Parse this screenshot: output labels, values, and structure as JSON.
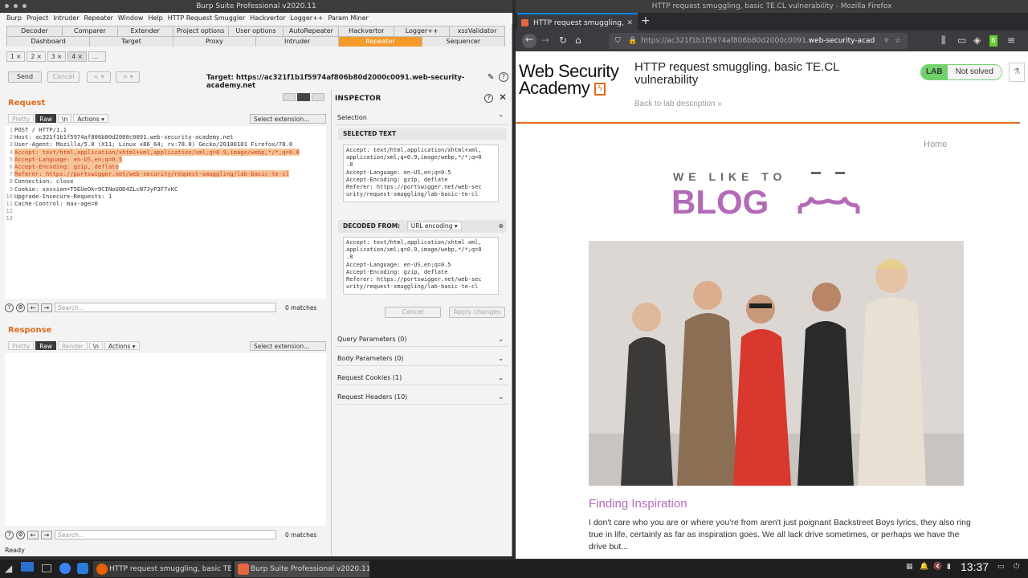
{
  "burp": {
    "title": "Burp Suite Professional v2020.11",
    "menu": [
      "Burp",
      "Project",
      "Intruder",
      "Repeater",
      "Window",
      "Help",
      "HTTP Request Smuggler",
      "Hackvertor",
      "Logger++",
      "Param Miner"
    ],
    "tabs_row1": [
      "Decoder",
      "Comparer",
      "Extender",
      "Project options",
      "User options",
      "AutoRepeater",
      "Hackvertor",
      "Logger++",
      "xssValidator"
    ],
    "tabs_row2": [
      "Dashboard",
      "Target",
      "Proxy",
      "Intruder",
      "Repeater",
      "Sequencer"
    ],
    "active_tab": "Repeater",
    "subtabs": [
      "1 ×",
      "2 ×",
      "3 ×",
      "4 ×",
      "..."
    ],
    "send_label": "Send",
    "cancel_label": "Cancel",
    "back_label": "< ▾",
    "fwd_label": "> ▾",
    "target": "Target: https://ac321f1b1f5974af806b80d2000c0091.web-security-academy.net",
    "request_title": "Request",
    "response_title": "Response",
    "req_tabs": [
      "Pretty",
      "Raw",
      "\\n",
      "Actions ▾"
    ],
    "resp_tabs": [
      "Pretty",
      "Raw",
      "Render",
      "\\n",
      "Actions ▾"
    ],
    "select_extension": "Select extension...",
    "request_lines": [
      {
        "n": "1",
        "text": "POST / HTTP/1.1",
        "hl": false
      },
      {
        "n": "2",
        "text": "Host: ac321f1b1f5974af806b80d2000c0091.web-security-academy.net",
        "hl": false
      },
      {
        "n": "3",
        "text": "User-Agent: Mozilla/5.0 (X11; Linux x86_64; rv:78.0) Gecko/20100101 Firefox/78.0",
        "hl": false
      },
      {
        "n": "4",
        "text": "Accept: text/html,application/xhtml+xml,application/xml;q=0.9,image/webp,*/*;q=0.8",
        "hl": true
      },
      {
        "n": "5",
        "text": "Accept-Language: en-US,en;q=0.5",
        "hl": true
      },
      {
        "n": "6",
        "text": "Accept-Encoding: gzip, deflate",
        "hl": true
      },
      {
        "n": "7",
        "text": "Referer: https://portswigger.net/web-security/request-smuggling/lab-basic-te-cl",
        "hl": true
      },
      {
        "n": "8",
        "text": "Connection: close",
        "hl": false
      },
      {
        "n": "9",
        "text": "Cookie: session=T5EUeOkr9CINoUOD4ZLcN7JyP3F7xKC",
        "hl": false
      },
      {
        "n": "10",
        "text": "Upgrade-Insecure-Requests: 1",
        "hl": false
      },
      {
        "n": "11",
        "text": "Cache-Control: max-age=0",
        "hl": false
      },
      {
        "n": "12",
        "text": "",
        "hl": false
      },
      {
        "n": "13",
        "text": "",
        "hl": false
      }
    ],
    "search_placeholder": "Search...",
    "matches": "0 matches",
    "status": "Ready"
  },
  "inspector": {
    "title": "INSPECTOR",
    "selection": "Selection",
    "selected_text_label": "SELECTED TEXT",
    "selected_text": "Accept: text/html,application/xhtml+xml,\napplication/xml;q=0.9,image/webp,*/*;q=0\n.8\nAccept-Language: en-US,en;q=0.5\nAccept-Encoding: gzip, deflate\nReferer: https://portswigger.net/web-sec\nurity/request-smuggling/lab-basic-te-cl",
    "decoded_from_label": "DECODED FROM:",
    "decoding": "URL encoding ▾",
    "decoded_text": "Accept: text/html,application/xhtml xml,\napplication/xml;q=0.9,image/webp,*/*;q=0\n.8\nAccept-Language: en-US,en;q=0.5\nAccept-Encoding: gzip, deflate\nReferer: https://portswigger.net/web-sec\nurity/request-smuggling/lab-basic-te-cl",
    "cancel_label": "Cancel",
    "apply_label": "Apply changes",
    "sections": [
      "Query Parameters (0)",
      "Body Parameters (0)",
      "Request Cookies (1)",
      "Request Headers (10)"
    ]
  },
  "firefox": {
    "window_title": "HTTP request smuggling, basic TE.CL vulnerability - Mozilla Firefox",
    "tab_title": "HTTP request smuggling,",
    "url_prefix": "https://ac321f1b1f5974af806b80d2000c0091.",
    "url_domain": "web-security-acad",
    "logo_line1": "Web Security",
    "logo_line2": "Academy",
    "lab_title": "HTTP request smuggling, basic TE.CL vulnerability",
    "back_link": "Back to lab description »",
    "lab_label": "LAB",
    "lab_status": "Not solved",
    "home_link": "Home",
    "blog_small": "WE LIKE TO",
    "blog_big": "BLOG",
    "post_title": "Finding Inspiration",
    "post_body": "I don't care who you are or where you're from aren't just poignant Backstreet Boys lyrics, they also ring true in life, certainly as far as inspiration goes. We all lack drive sometimes, or perhaps we have the drive but..."
  },
  "taskbar": {
    "items": [
      "HTTP request smuggling, basic TE...",
      "Burp Suite Professional v2020.11 -..."
    ],
    "clock": "13:37"
  },
  "colors": {
    "accent_orange": "#e06a1b",
    "lab_green": "#70d16d",
    "blog_purple": "#b36ab8"
  }
}
